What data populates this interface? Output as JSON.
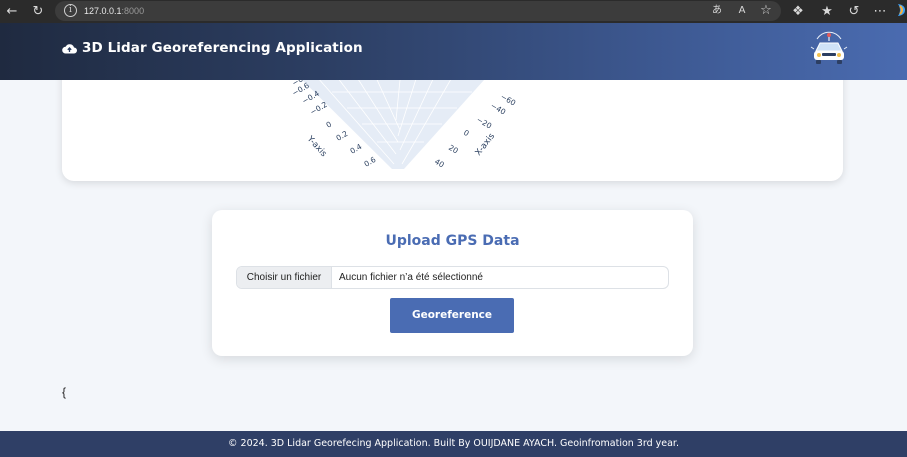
{
  "browser": {
    "url_host": "127.0.0.1",
    "url_port": ":8000",
    "icons": [
      "back-icon",
      "refresh-icon",
      "info-icon",
      "read-aloud-icon",
      "text-size-icon",
      "favorite-star-icon",
      "extensions-icon",
      "favorites-icon",
      "history-icon",
      "more-icon",
      "copilot-icon"
    ]
  },
  "header": {
    "title": "3D Lidar Georeferencing Application",
    "logo_icon": "cloud-upload-icon",
    "brand_icon": "lidar-car-icon"
  },
  "plot": {
    "y_axis_title": "Y-axis",
    "x_axis_title": "X-axis",
    "y_ticks": [
      "−0.6",
      "−0.4",
      "−0.2",
      "0",
      "0.2",
      "0.4",
      "0.6"
    ],
    "x_ticks": [
      "−60",
      "−40",
      "−20",
      "0",
      "20",
      "40"
    ],
    "colors": {
      "plane": "#e5ecf6",
      "grid": "#ffffff",
      "tick": "#2a3f5f"
    }
  },
  "upload": {
    "title": "Upload GPS Data",
    "file_button": "Choisir un fichier",
    "file_status": "Aucun fichier n’a été sélectionné",
    "submit": "Georeference"
  },
  "stray_text": "{",
  "footer": {
    "text": "© 2024. 3D Lidar Georefecing Application. Built By OUIJDANE AYACH. Geoinfromation 3rd year."
  },
  "colors": {
    "accent": "#4a6cb3",
    "header_start": "#1f2a40",
    "header_end": "#4a6bb0",
    "footer": "#2f3f66",
    "page_bg": "#f3f6fa"
  }
}
